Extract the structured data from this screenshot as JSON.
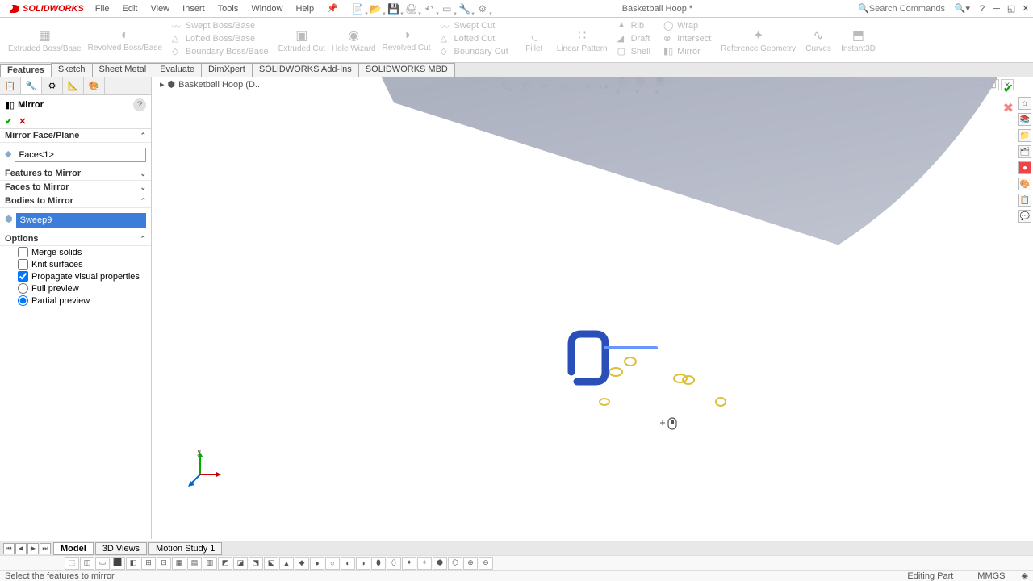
{
  "app": {
    "name": "SOLIDWORKS",
    "doc_title": "Basketball Hoop *",
    "search_placeholder": "Search Commands"
  },
  "menu": [
    "File",
    "Edit",
    "View",
    "Insert",
    "Tools",
    "Window",
    "Help"
  ],
  "ribbon": {
    "features": {
      "extruded_boss": "Extruded Boss/Base",
      "revolved_boss": "Revolved Boss/Base",
      "swept_boss": "Swept Boss/Base",
      "lofted_boss": "Lofted Boss/Base",
      "boundary_boss": "Boundary Boss/Base",
      "extruded_cut": "Extruded Cut",
      "hole_wizard": "Hole Wizard",
      "revolved_cut": "Revolved Cut",
      "swept_cut": "Swept Cut",
      "lofted_cut": "Lofted Cut",
      "boundary_cut": "Boundary Cut",
      "fillet": "Fillet",
      "linear_pattern": "Linear Pattern",
      "rib": "Rib",
      "draft": "Draft",
      "shell": "Shell",
      "wrap": "Wrap",
      "intersect": "Intersect",
      "mirror": "Mirror",
      "reference": "Reference Geometry",
      "curves": "Curves",
      "instant3d": "Instant3D"
    }
  },
  "tabs": [
    "Features",
    "Sketch",
    "Sheet Metal",
    "Evaluate",
    "DimXpert",
    "SOLIDWORKS Add-Ins",
    "SOLIDWORKS MBD"
  ],
  "breadcrumb": "Basketball Hoop  (D...",
  "propmgr": {
    "title": "Mirror",
    "sections": {
      "mirror_face": {
        "title": "Mirror Face/Plane",
        "value": "Face<1>"
      },
      "features_to_mirror": {
        "title": "Features to Mirror"
      },
      "faces_to_mirror": {
        "title": "Faces to Mirror"
      },
      "bodies_to_mirror": {
        "title": "Bodies to Mirror",
        "value": "Sweep9"
      },
      "options": {
        "title": "Options",
        "merge": "Merge solids",
        "knit": "Knit surfaces",
        "propagate": "Propagate visual properties",
        "full": "Full preview",
        "partial": "Partial preview"
      }
    }
  },
  "bottom_tabs": [
    "Model",
    "3D Views",
    "Motion Study 1"
  ],
  "status": {
    "hint": "Select the features to mirror",
    "mode": "Editing Part",
    "units": "MMGS"
  }
}
